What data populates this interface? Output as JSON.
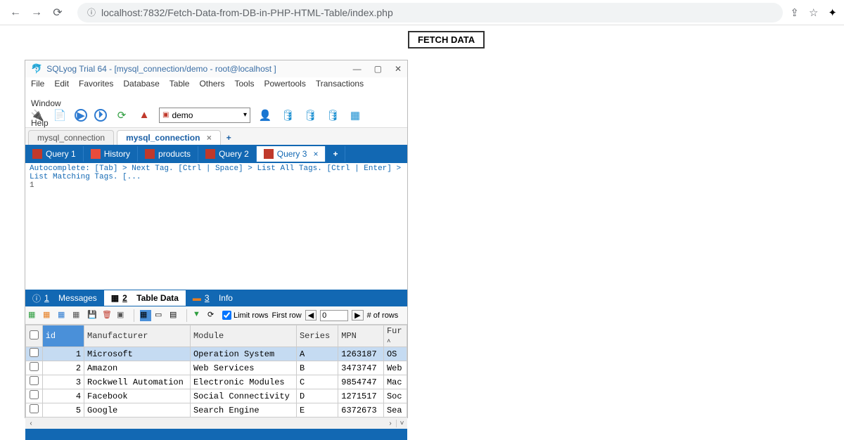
{
  "browser": {
    "url": "localhost:7832/Fetch-Data-from-DB-in-PHP-HTML-Table/index.php"
  },
  "page": {
    "fetch_button": "FETCH DATA"
  },
  "sqlyog": {
    "title": "SQLyog Trial 64 - [mysql_connection/demo - root@localhost ]",
    "menu": [
      "File",
      "Edit",
      "Favorites",
      "Database",
      "Table",
      "Others",
      "Tools",
      "Powertools",
      "Transactions",
      "Window",
      "Help"
    ],
    "db_selected": "demo",
    "conn_tabs": {
      "inactive": "mysql_connection",
      "active": "mysql_connection"
    },
    "query_tabs": [
      {
        "label": "Query 1"
      },
      {
        "label": "History"
      },
      {
        "label": "products"
      },
      {
        "label": "Query 2"
      },
      {
        "label": "Query 3",
        "active": true
      }
    ],
    "autocomplete_hint": "Autocomplete: [Tab] > Next Tag. [Ctrl | Space] > List All Tags. [Ctrl | Enter] > List Matching Tags. [...",
    "line_number": "1",
    "result_tabs": {
      "messages": "Messages",
      "table_data": "Table Data",
      "info": "Info"
    },
    "toolbar": {
      "limit_rows": "Limit rows",
      "first_row": "First row",
      "page_value": "0",
      "rows_label": "# of rows"
    },
    "grid": {
      "columns": [
        "id",
        "Manufacturer",
        "Module",
        "Series",
        "MPN",
        "Fur"
      ],
      "rows": [
        {
          "id": "1",
          "Manufacturer": "Microsoft",
          "Module": "Operation System",
          "Series": "A",
          "MPN": "1263187",
          "Fur": "OS"
        },
        {
          "id": "2",
          "Manufacturer": "Amazon",
          "Module": "Web Services",
          "Series": "B",
          "MPN": "3473747",
          "Fur": "Web"
        },
        {
          "id": "3",
          "Manufacturer": "Rockwell Automation",
          "Module": "Electronic Modules",
          "Series": "C",
          "MPN": "9854747",
          "Fur": "Mac"
        },
        {
          "id": "4",
          "Manufacturer": "Facebook",
          "Module": "Social Connectivity",
          "Series": "D",
          "MPN": "1271517",
          "Fur": "Soc"
        },
        {
          "id": "5",
          "Manufacturer": "Google",
          "Module": "Search Engine",
          "Series": "E",
          "MPN": "6372673",
          "Fur": "Sea"
        }
      ]
    }
  }
}
